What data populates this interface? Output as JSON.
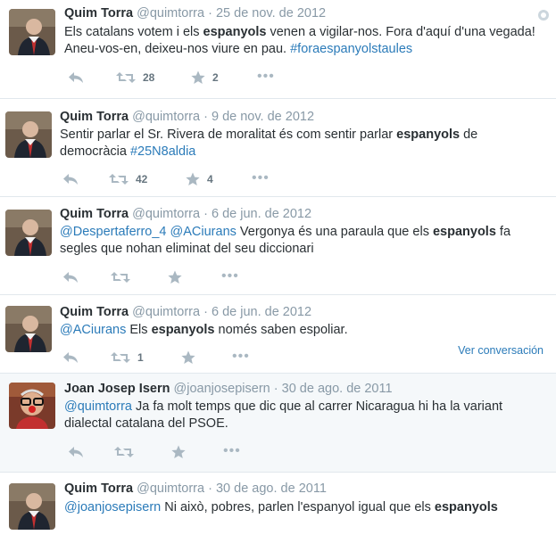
{
  "tweets": [
    {
      "name": "Quim Torra",
      "handle": "@quimtorra",
      "date": "25 de nov. de 2012",
      "text": [
        {
          "t": "Els catalans votem i els "
        },
        {
          "t": "espanyols",
          "b": true
        },
        {
          "t": " venen a vigilar-nos. Fora d'aquí d'una vegada! Aneu-vos-en, deixeu-nos viure en pau. "
        },
        {
          "t": "#foraespanyolstaules",
          "link": true
        }
      ],
      "retweets": "28",
      "favorites": "2"
    },
    {
      "name": "Quim Torra",
      "handle": "@quimtorra",
      "date": "9 de nov. de 2012",
      "text": [
        {
          "t": "Sentir parlar el Sr. Rivera de moralitat és com sentir parlar "
        },
        {
          "t": "espanyols",
          "b": true
        },
        {
          "t": " de democràcia "
        },
        {
          "t": "#25N8aldia",
          "link": true
        }
      ],
      "retweets": "42",
      "favorites": "4"
    },
    {
      "name": "Quim Torra",
      "handle": "@quimtorra",
      "date": "6 de jun. de 2012",
      "text": [
        {
          "t": "@Despertaferro_4",
          "link": true
        },
        {
          "t": " "
        },
        {
          "t": "@ACiurans",
          "link": true
        },
        {
          "t": " Vergonya és una paraula que els "
        },
        {
          "t": "espanyols",
          "b": true
        },
        {
          "t": " fa segles que nohan eliminat del seu diccionari"
        }
      ],
      "retweets": "",
      "favorites": ""
    },
    {
      "name": "Quim Torra",
      "handle": "@quimtorra",
      "date": "6 de jun. de 2012",
      "text": [
        {
          "t": "@ACiurans",
          "link": true
        },
        {
          "t": " Els "
        },
        {
          "t": "espanyols",
          "b": true
        },
        {
          "t": " només saben espoliar."
        }
      ],
      "retweets": "1",
      "favorites": "",
      "conversation": "Ver conversación"
    },
    {
      "name": "Joan Josep Isern",
      "handle": "@joanjosepisern",
      "date": "30 de ago. de 2011",
      "text": [
        {
          "t": "@quimtorra",
          "link": true
        },
        {
          "t": " Ja fa molt temps que dic que al carrer Nicaragua hi ha la variant dialectal catalana del PSOE."
        }
      ],
      "retweets": "",
      "favorites": ""
    },
    {
      "name": "Quim Torra",
      "handle": "@quimtorra",
      "date": "30 de ago. de 2011",
      "text": [
        {
          "t": "@joanjosepisern",
          "link": true
        },
        {
          "t": " Ni això, pobres, parlen l'espanyol igual que els "
        },
        {
          "t": "espanyols",
          "b": true
        }
      ],
      "retweets": "",
      "favorites": ""
    }
  ],
  "colors": {
    "link": "#2b7bb9",
    "muted": "#8899a6",
    "text": "#292f33",
    "highlight_bg": "#f5f8fa"
  },
  "icons": {
    "reply": "reply-icon",
    "retweet": "retweet-icon",
    "favorite": "star-icon",
    "more": "more-icon"
  }
}
